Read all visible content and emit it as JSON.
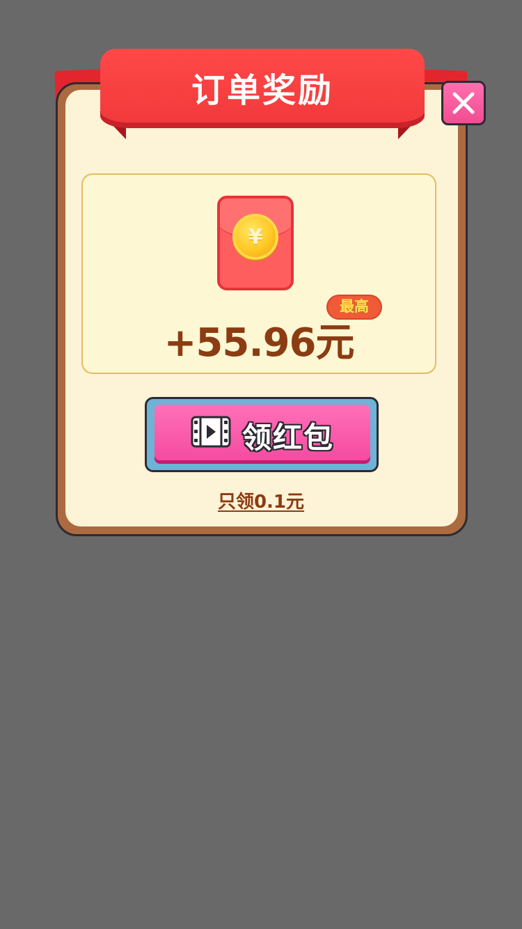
{
  "dialog": {
    "title": "订单奖励"
  },
  "reward": {
    "amount": "+55.96元",
    "badge": "最高",
    "coin_symbol": "¥",
    "envelope_icon": "red-envelope-icon",
    "coin_icon": "yuan-coin-icon"
  },
  "actions": {
    "claim_label": "领红包",
    "claim_icon": "video-icon",
    "small_link": "只领0.1元"
  },
  "colors": {
    "background_overlay": "#696969",
    "ribbon": "#ff4848",
    "card_border": "#ab6a3f",
    "card_fill": "#fdf3d6",
    "amount_text": "#8b3c12",
    "claim_button": "#f54ba0",
    "close_button": "#f14d93"
  }
}
